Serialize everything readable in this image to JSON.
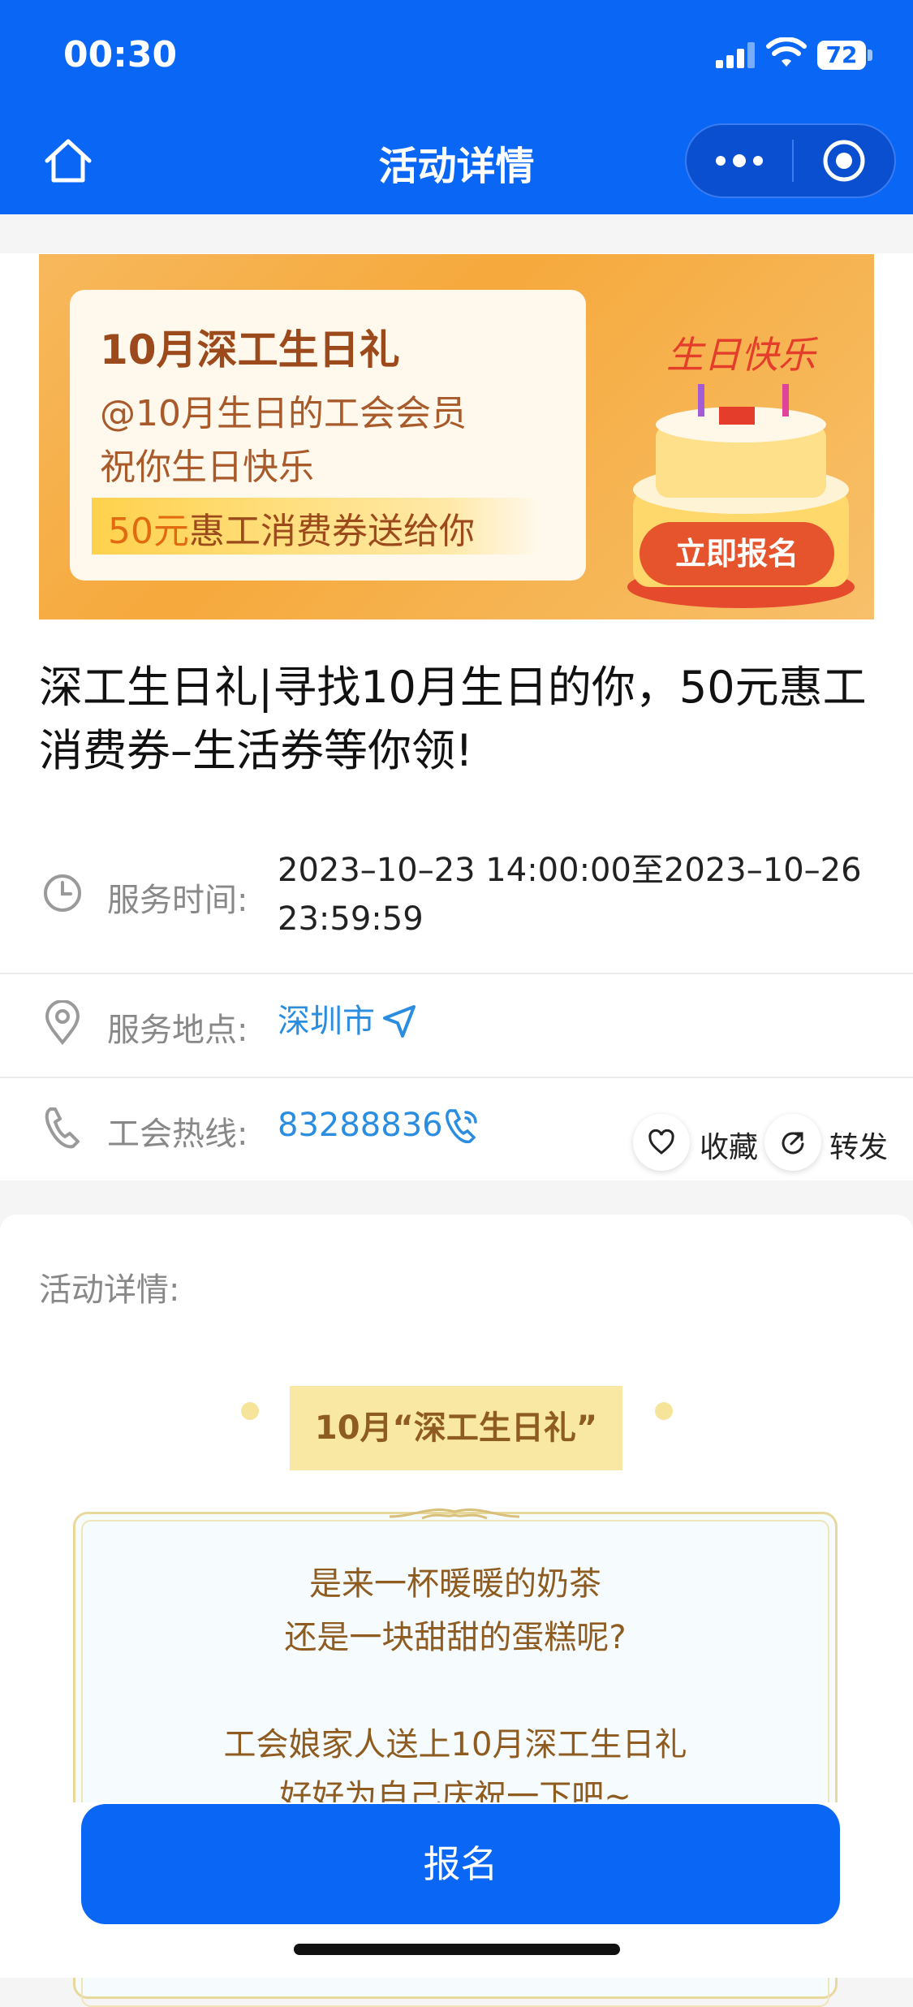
{
  "status_bar": {
    "time": "00:30",
    "battery": "72"
  },
  "nav": {
    "title": "活动详情"
  },
  "banner": {
    "line1": "10月深工生日礼",
    "line2": "@10月生日的工会会员",
    "line3": "祝你生日快乐",
    "line4_highlight": "50元",
    "line4_rest": "惠工消费券送给你",
    "signup_pill": "立即报名",
    "cake_text": "生日快乐"
  },
  "event": {
    "title": "深工生日礼|寻找10月生日的你，50元惠工消费券–生活券等你领!",
    "time_label": "服务时间:",
    "time_value": "2023–10–23 14:00:00至2023–10–26 23:59:59",
    "place_label": "服务地点:",
    "place_value": "深圳市",
    "hotline_label": "工会热线:",
    "hotline_value": "83288836"
  },
  "actions": {
    "favorite": "收藏",
    "share": "转发"
  },
  "details": {
    "label": "活动详情:",
    "ribbon": "10月“深工生日礼”",
    "p1": "是来一杯暖暖的奶茶",
    "p2": "还是一块甜甜的蛋糕呢?",
    "p3": "工会娘家人送上10月深工生日礼",
    "p4": "好好为自己庆祝一下吧~"
  },
  "bottom": {
    "signup": "报名"
  },
  "colors": {
    "primary": "#0a66f5",
    "link": "#2a8de0",
    "banner": "#f6a93c"
  }
}
